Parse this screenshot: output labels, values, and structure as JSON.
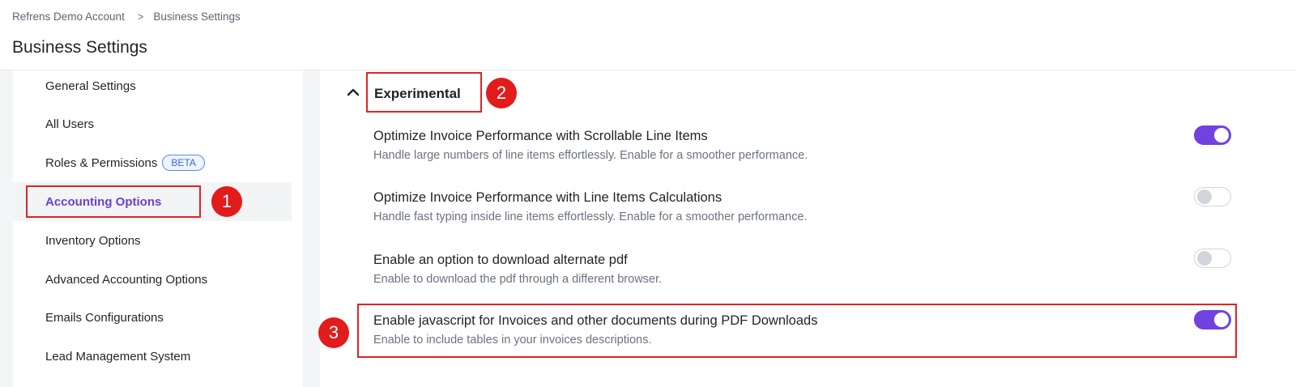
{
  "breadcrumb": {
    "account": "Refrens Demo Account",
    "separator": ">",
    "current": "Business Settings"
  },
  "page_title": "Business Settings",
  "sidebar": {
    "items": [
      {
        "label": "General Settings"
      },
      {
        "label": "All Users"
      },
      {
        "label": "Roles & Permissions",
        "badge": "BETA"
      },
      {
        "label": "Accounting Options",
        "active": true
      },
      {
        "label": "Inventory Options"
      },
      {
        "label": "Advanced Accounting Options"
      },
      {
        "label": "Emails Configurations"
      },
      {
        "label": "Lead Management System"
      }
    ]
  },
  "section": {
    "title": "Experimental",
    "icon": "chevron-up-icon"
  },
  "settings": [
    {
      "title": "Optimize Invoice Performance with Scrollable Line Items",
      "description": "Handle large numbers of line items effortlessly. Enable for a smoother performance.",
      "enabled": true
    },
    {
      "title": "Optimize Invoice Performance with Line Items Calculations",
      "description": "Handle fast typing inside line items effortlessly. Enable for a smoother performance.",
      "enabled": false
    },
    {
      "title": "Enable an option to download alternate pdf",
      "description": "Enable to download the pdf through a different browser.",
      "enabled": false
    },
    {
      "title": "Enable javascript for Invoices and other documents during PDF Downloads",
      "description": "Enable to include tables in your invoices descriptions.",
      "enabled": true
    }
  ],
  "annotations": {
    "marker_1": "1",
    "marker_2": "2",
    "marker_3": "3"
  },
  "colors": {
    "accent": "#7043e0",
    "active_text": "#6b3fd6",
    "annotation_red": "#e21b1b",
    "badge_blue": "#2f6fd0"
  }
}
